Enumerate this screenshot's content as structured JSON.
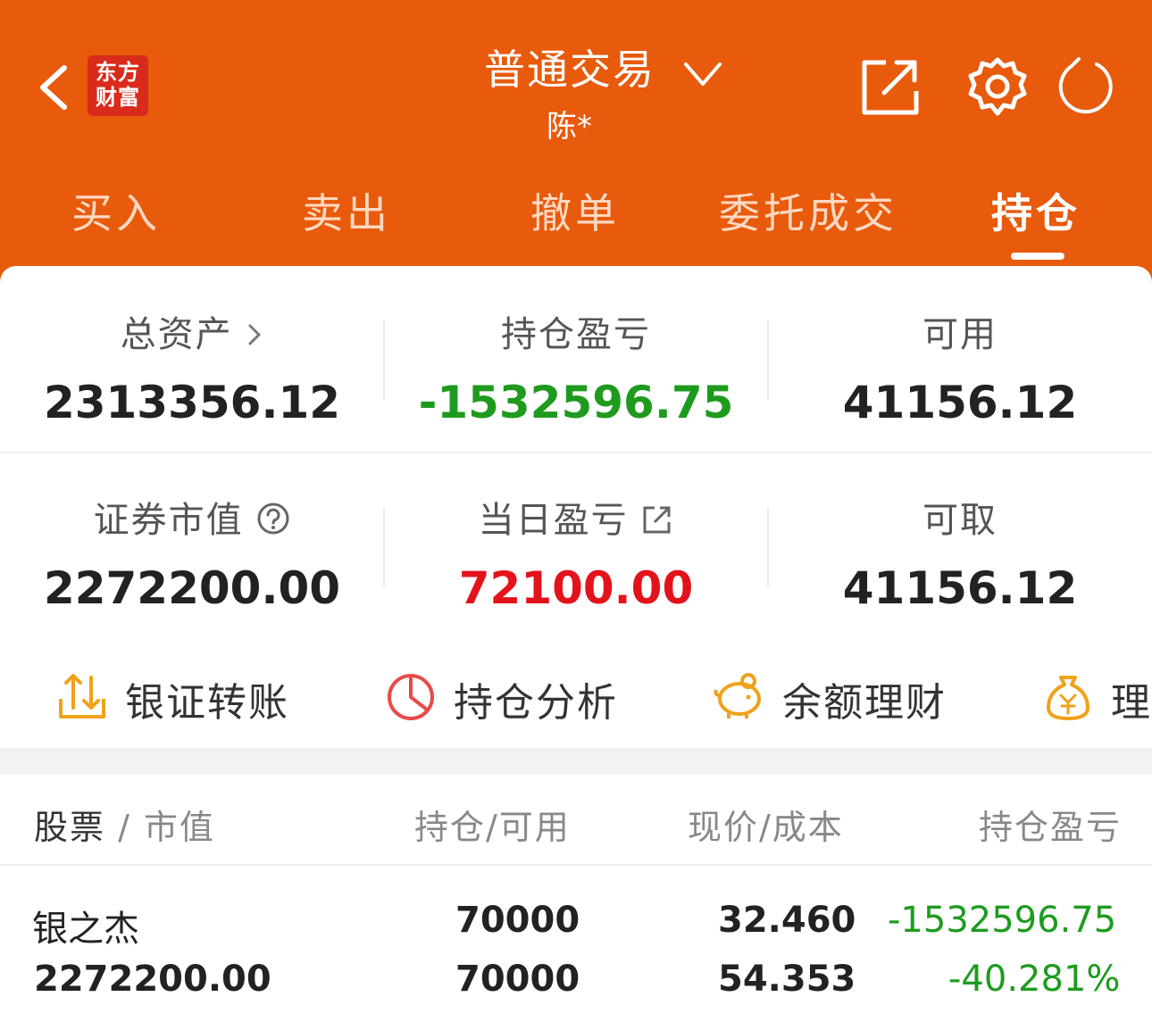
{
  "header": {
    "logo_line1": "东方",
    "logo_line2": "财富",
    "title": "普通交易",
    "account": "陈*"
  },
  "tabs": [
    "买入",
    "卖出",
    "撤单",
    "委托成交",
    "持仓"
  ],
  "active_tab": "持仓",
  "summary": {
    "total_assets_label": "总资产",
    "total_assets": "2313356.12",
    "position_pl_label": "持仓盈亏",
    "position_pl": "-1532596.75",
    "available_label": "可用",
    "available": "41156.12",
    "market_value_label": "证券市值",
    "market_value": "2272200.00",
    "daily_pl_label": "当日盈亏",
    "daily_pl": "72100.00",
    "withdrawable_label": "可取",
    "withdrawable": "41156.12"
  },
  "actions": [
    "银证转账",
    "持仓分析",
    "余额理财",
    "理财"
  ],
  "table": {
    "col1_a": "股票",
    "col1_b": "市值",
    "col2": "持仓/可用",
    "col3": "现价/成本",
    "col4": "持仓盈亏",
    "rows": [
      {
        "name": "银之杰",
        "market_value": "2272200.00",
        "position": "70000",
        "available": "70000",
        "price": "32.460",
        "cost": "54.353",
        "pl": "-1532596.75",
        "pl_pct": "-40.281%"
      }
    ]
  },
  "colors": {
    "brand": "#e85a0c",
    "loss": "#1e9b1e",
    "gain": "#e3131b"
  }
}
